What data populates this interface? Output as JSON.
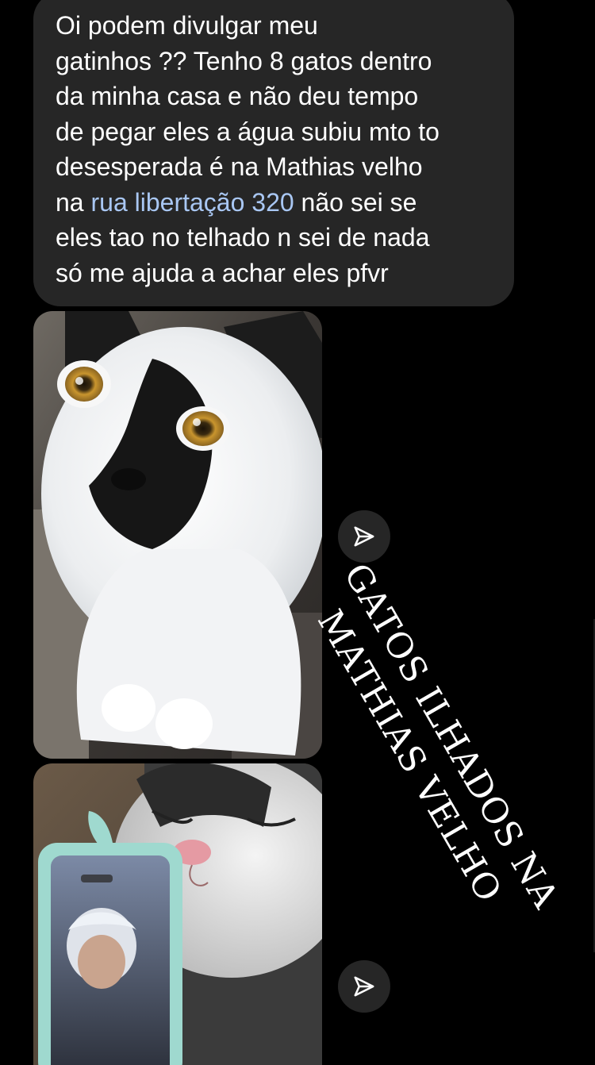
{
  "message": {
    "lines": [
      "Oi podem divulgar meu",
      "gatinhos ?? Tenho 8 gatos dentro",
      "da minha casa e não deu tempo",
      "de pegar eles a água subiu mto to",
      "desesperada é na Mathias velho"
    ],
    "line6_prefix": "na ",
    "line6_link": "rua libertação 320",
    "line6_suffix": " não sei se",
    "line7": "eles tao no telhado n sei de nada",
    "line8": "só me ajuda a achar eles pfvr"
  },
  "overlay": {
    "line1": "GATOS ILHADOS NA",
    "line2": "MATHIAS VELHO"
  },
  "icons": {
    "share": "send-arrow-icon"
  },
  "colors": {
    "background": "#000000",
    "bubble": "#262626",
    "link": "#a9c7f3"
  }
}
